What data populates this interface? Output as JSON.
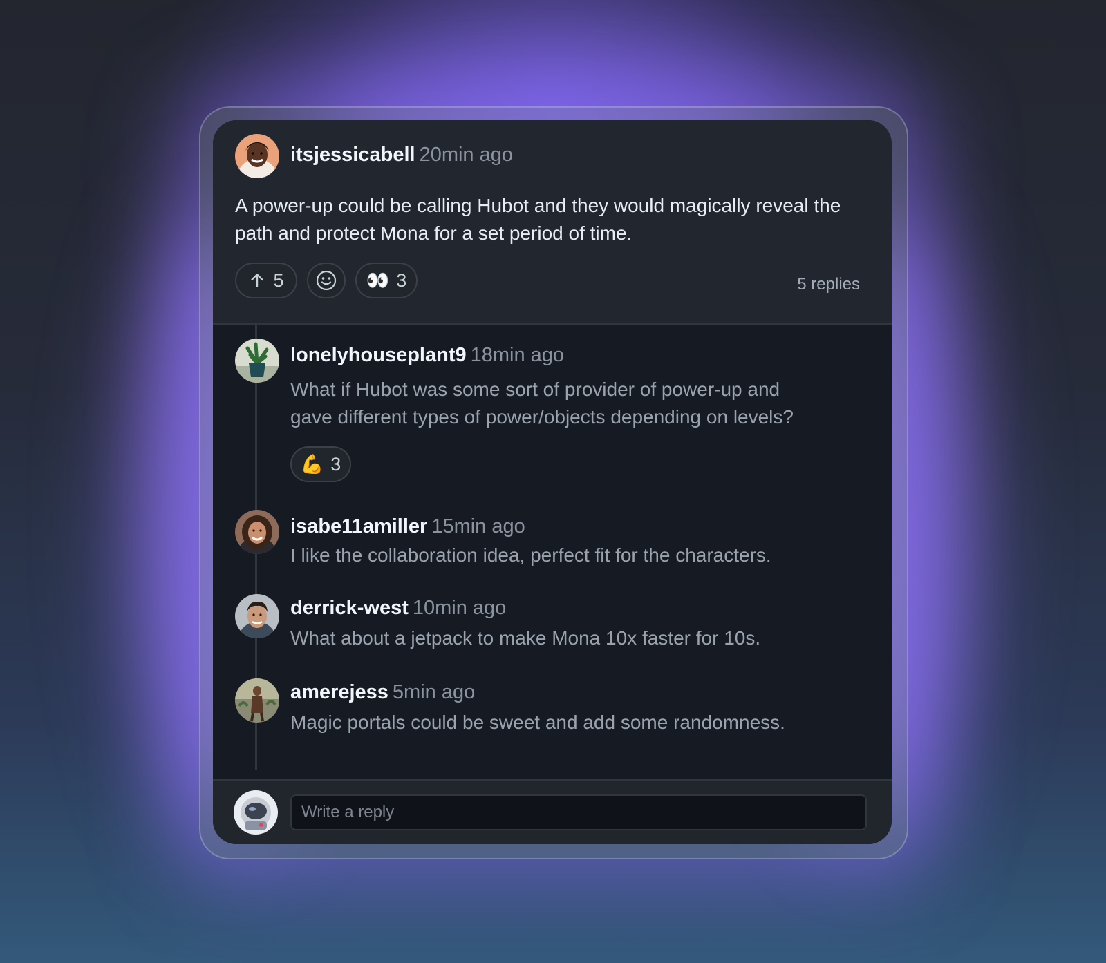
{
  "post": {
    "username": "itsjessicabell",
    "time": "20min ago",
    "body": "A power-up could be calling Hubot and they would magically reveal the path and protect Mona for a set period of time.",
    "reactions": {
      "upvote_count": "5",
      "eyes_emoji": "👀",
      "eyes_count": "3"
    },
    "replies_label": "5 replies"
  },
  "replies": [
    {
      "username": "lonelyhouseplant9",
      "time": "18min ago",
      "body_line1": "What if Hubot was some sort of provider of power-up and",
      "body_line2": "gave different types of power/objects depending on levels?",
      "reaction_emoji": "💪",
      "reaction_count": "3"
    },
    {
      "username": "isabe11amiller",
      "time": "15min ago",
      "body": "I like the collaboration idea, perfect fit for the characters."
    },
    {
      "username": "derrick-west",
      "time": "10min ago",
      "body": "What about a jetpack to make Mona 10x faster for 10s."
    },
    {
      "username": "amerejess",
      "time": "5min ago",
      "body": "Magic portals could be sweet and add some randomness."
    }
  ],
  "composer": {
    "placeholder": "Write a reply"
  },
  "colors": {
    "accent_glow": "#8c6eff",
    "card_bg": "#161b23",
    "header_bg": "#22272f"
  }
}
